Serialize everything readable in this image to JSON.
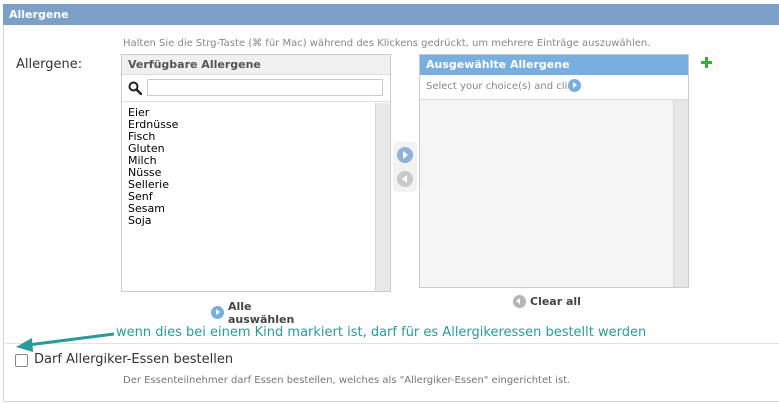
{
  "section": {
    "title": "Allergene"
  },
  "help_top": "Halten Sie die Strg-Taste (⌘ für Mac) während des Klickens gedrückt, um mehrere Einträge auszuwählen.",
  "field_label": "Allergene:",
  "available": {
    "title": "Verfügbare Allergene",
    "filter_value": "",
    "items": [
      "Eier",
      "Erdnüsse",
      "Fisch",
      "Gluten",
      "Milch",
      "Nüsse",
      "Sellerie",
      "Senf",
      "Sesam",
      "Soja"
    ]
  },
  "chosen": {
    "title": "Ausgewählte Allergene",
    "hint": "Select your choice(s) and click",
    "items": []
  },
  "buttons": {
    "choose_all": "Alle auswählen",
    "clear_all": "Clear all"
  },
  "annotation": "wenn dies bei einem Kind markiert ist, darf für es Allergikeressen bestellt werden",
  "checkbox": {
    "label": "Darf Allergiker-Essen bestellen",
    "checked": false,
    "help": "Der Essenteilnehmer darf Essen bestellen, welches als \"Allergiker-Essen\" eingerichtet ist."
  },
  "colors": {
    "header": "#7ca0c7",
    "chosen_header": "#79aee0",
    "annotation": "#2a9a9a",
    "add_icon": "#3cae3c"
  }
}
